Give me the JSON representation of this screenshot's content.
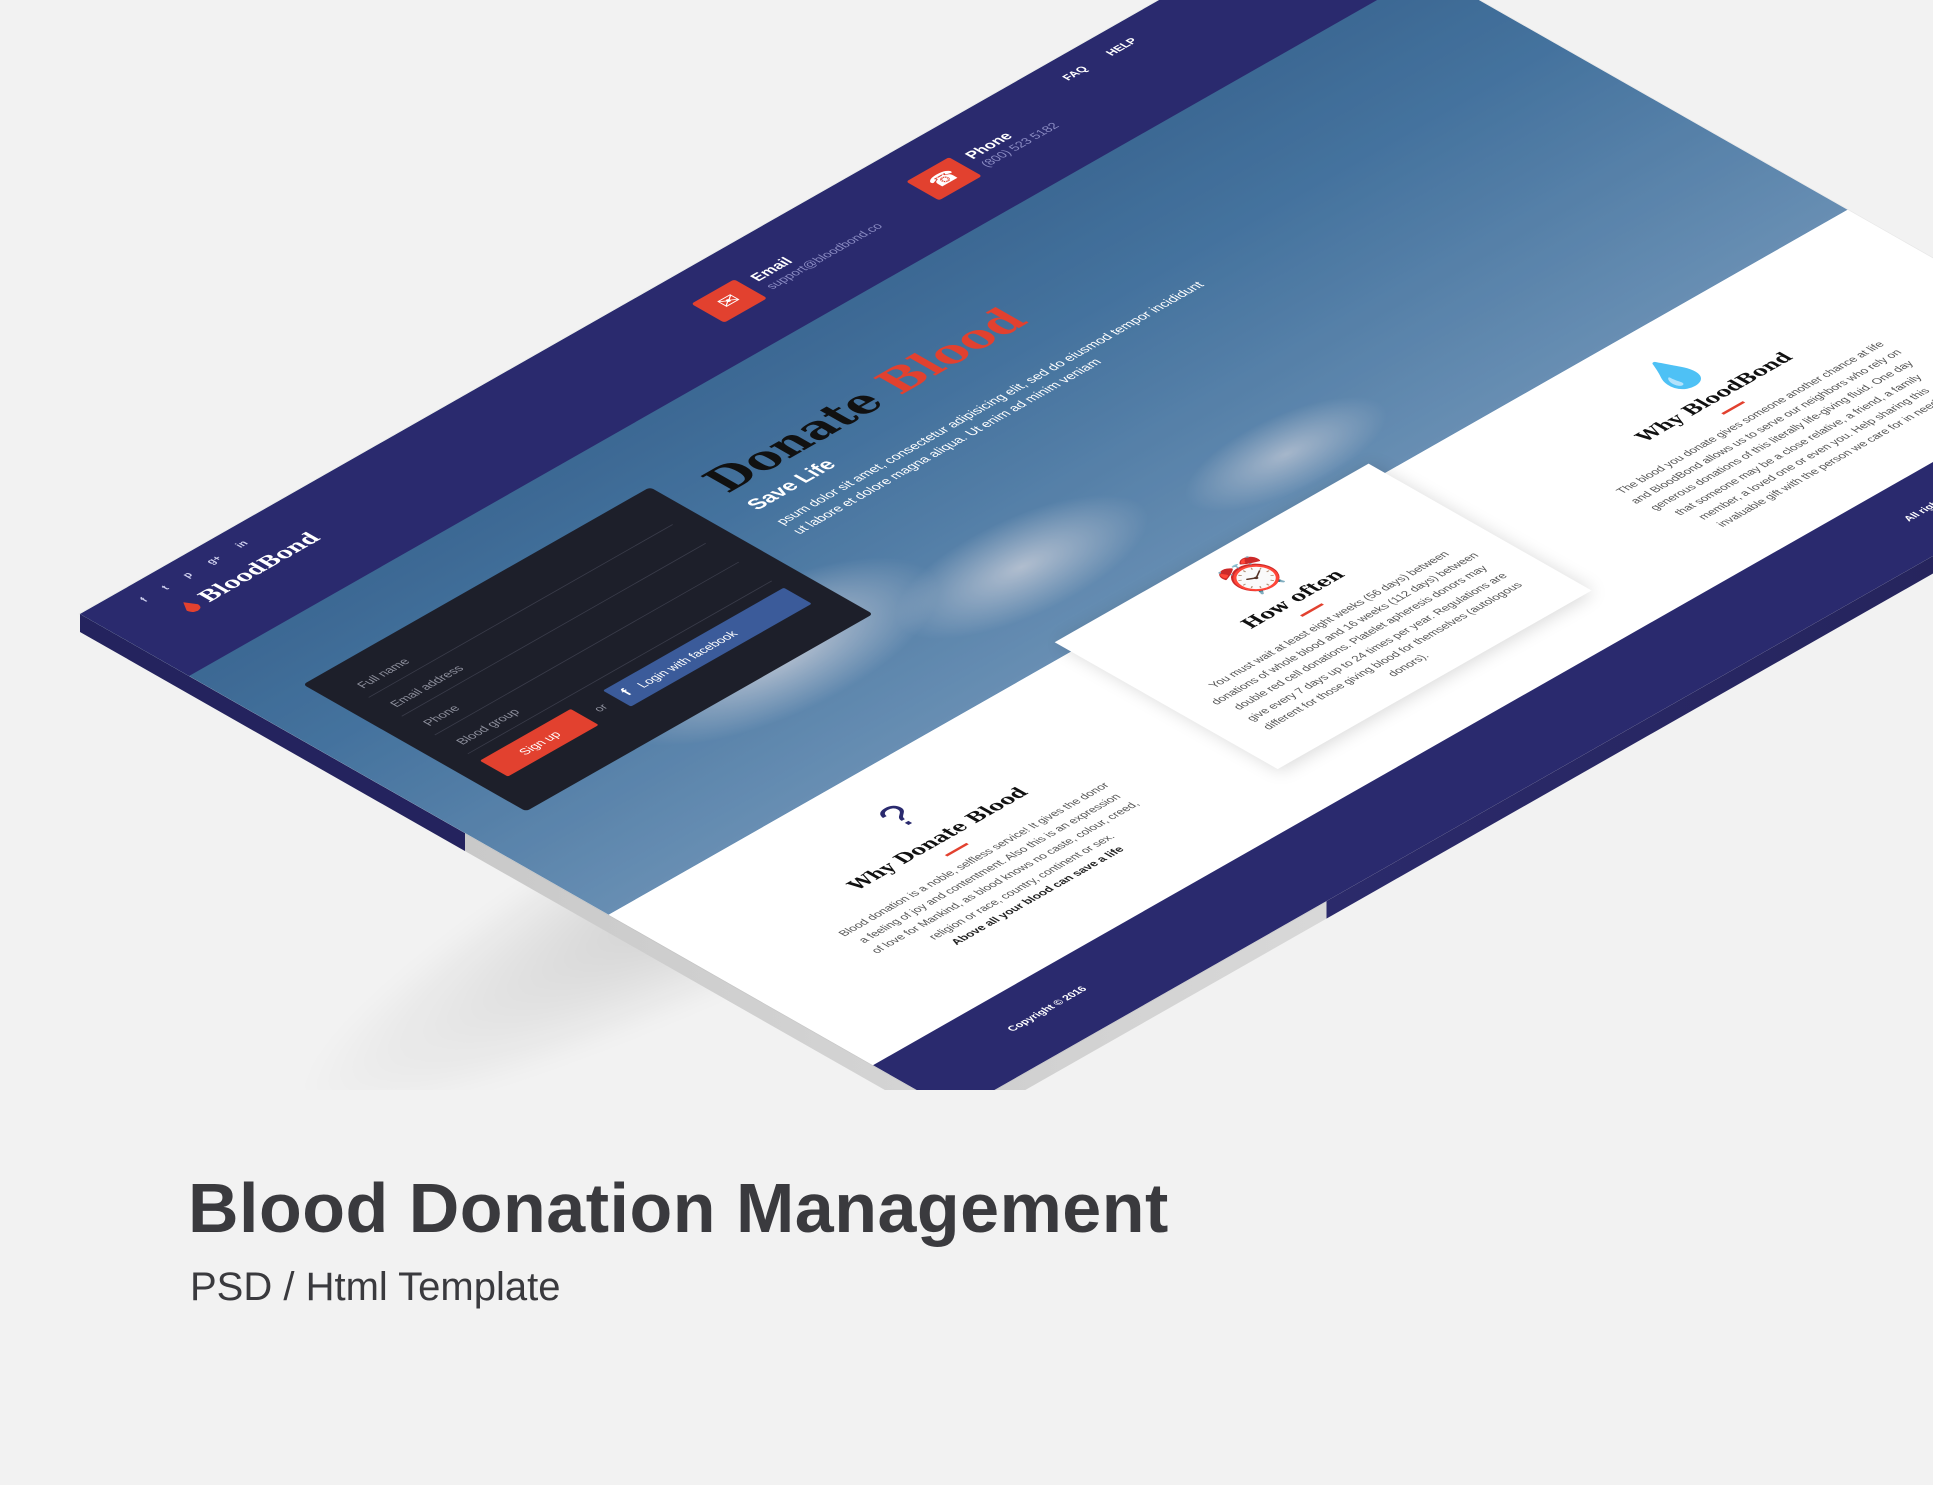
{
  "mockup": {
    "brand": "BloodBond",
    "social_icons": [
      "f",
      "t",
      "p",
      "g+",
      "in"
    ],
    "social_icon_names": [
      "facebook-icon",
      "twitter-icon",
      "pinterest-icon",
      "google-plus-icon",
      "linkedin-icon"
    ],
    "nav": {
      "faq": "FAQ",
      "help": "HELP"
    },
    "contact_email": {
      "label": "Email",
      "value": "support@bloodbond.co"
    },
    "contact_phone": {
      "label": "Phone",
      "value": "(800) 523 5182"
    },
    "hero": {
      "title_part1": "Donate ",
      "title_part2": "Blood",
      "subtitle": "Save Life",
      "text": "psum dolor sit amet, consectetur adipisicing elit, sed do eiusmod tempor incididunt ut labore et dolore magna aliqua. Ut enim ad minim veniam"
    },
    "signup_form": {
      "full_name": "Full name",
      "email": "Email address",
      "phone": "Phone",
      "blood_group": "Blood group",
      "signup_button": "Sign up",
      "or": "or",
      "facebook_button": "Login with facebook"
    },
    "features": [
      {
        "title": "Why Donate Blood",
        "text": "Blood donation is a noble, selfless service! It gives the donor a feeling of joy and contentment. Also this is an expression of love for Mankind, as blood knows no caste, colour, creed, religion or race, country, continent or sex.",
        "emphasis": "Above all your blood can save a life"
      },
      {
        "title": "How often",
        "text": "You must wait at least eight weeks (56 days) between donations of whole blood and 16 weeks (112 days) between double red cell donations. Platelet apheresis donors may give every 7 days up to 24 times per year. Regulations are different for those giving blood for themselves (autologous donors)."
      },
      {
        "title": "Why BloodBond",
        "text": "The blood you donate gives someone another chance at life and BloodBond allows us to serve our neighbors who rely on generous donations of this literally life-giving fluid. One day that someone may be a close relative, a friend, a family member, a loved one or even you. Help sharing this invaluable gift with the person we care for in need."
      }
    ],
    "footer": {
      "copyright": "Copyright © 2016",
      "rights": "All rights reserved by BloodBond"
    }
  },
  "caption": {
    "title": "Blood Donation Management",
    "subtitle": "PSD / Html Template"
  },
  "colors": {
    "primary_navy": "#2a2a6e",
    "accent_red": "#e2412f",
    "background": "#f2f2f2",
    "caption_text": "#3a3a3e"
  }
}
